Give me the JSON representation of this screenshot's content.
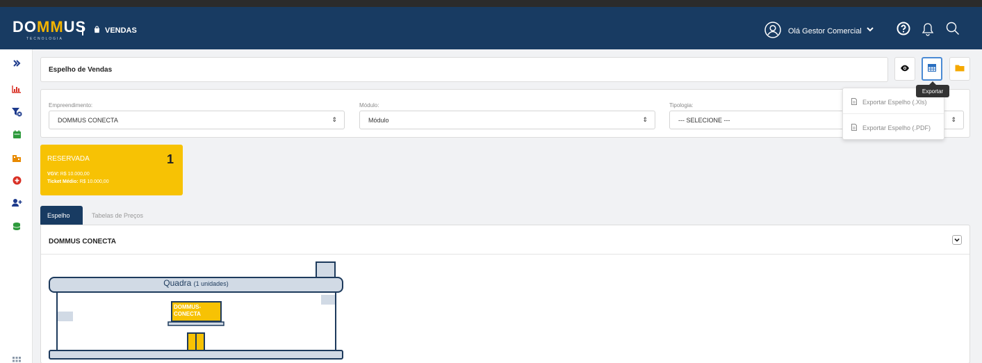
{
  "header": {
    "logo_text_pre": "DO",
    "logo_text_mm": "MM",
    "logo_text_post": "US",
    "logo_sub": "TECNOLOGIA",
    "module": "VENDAS",
    "greeting": "Olá Gestor Comercial",
    "icons": [
      "user-circle-icon",
      "chevron-down-icon",
      "help-icon",
      "bell-icon",
      "search-icon"
    ]
  },
  "sidebar": {
    "items": [
      "expand-icon",
      "chart-icon",
      "filter-icon",
      "calendar-icon",
      "building-icon",
      "plus-circle-icon",
      "add-user-icon",
      "money-icon",
      "apps-icon"
    ]
  },
  "page": {
    "title": "Espelho de Vendas"
  },
  "toolbar": {
    "buttons": [
      "eye-icon",
      "table-icon",
      "folder-icon"
    ],
    "tooltip": "Exportar"
  },
  "export_menu": {
    "items": [
      "Exportar Espelho (.Xls)",
      "Exportar Espelho (.PDF)"
    ]
  },
  "filters": {
    "empreendimento": {
      "label": "Empreendimento:",
      "value": "DOMMUS CONECTA"
    },
    "modulo": {
      "label": "Módulo:",
      "value": "Módulo"
    },
    "tipologia": {
      "label": "Tipologia:",
      "value": "--- SELECIONE ---"
    }
  },
  "status_card": {
    "title": "RESERVADA",
    "count": "1",
    "vgv_label": "VGV:",
    "vgv_value": "R$ 10.000,00",
    "ticket_label": "Ticket Médio:",
    "ticket_value": "R$ 10.000,00",
    "color": "#f7c204"
  },
  "tabs": [
    "Espelho",
    "Tabelas de Preços"
  ],
  "main": {
    "title": "DOMMUS CONECTA",
    "quadra_label": "Quadra",
    "quadra_count": "(1 unidades)",
    "unit_label": "DOMMUS-CONECTA"
  },
  "colors": {
    "navbar": "#183b62",
    "accent": "#f7c204",
    "active_button_border": "#4a8ad4"
  }
}
